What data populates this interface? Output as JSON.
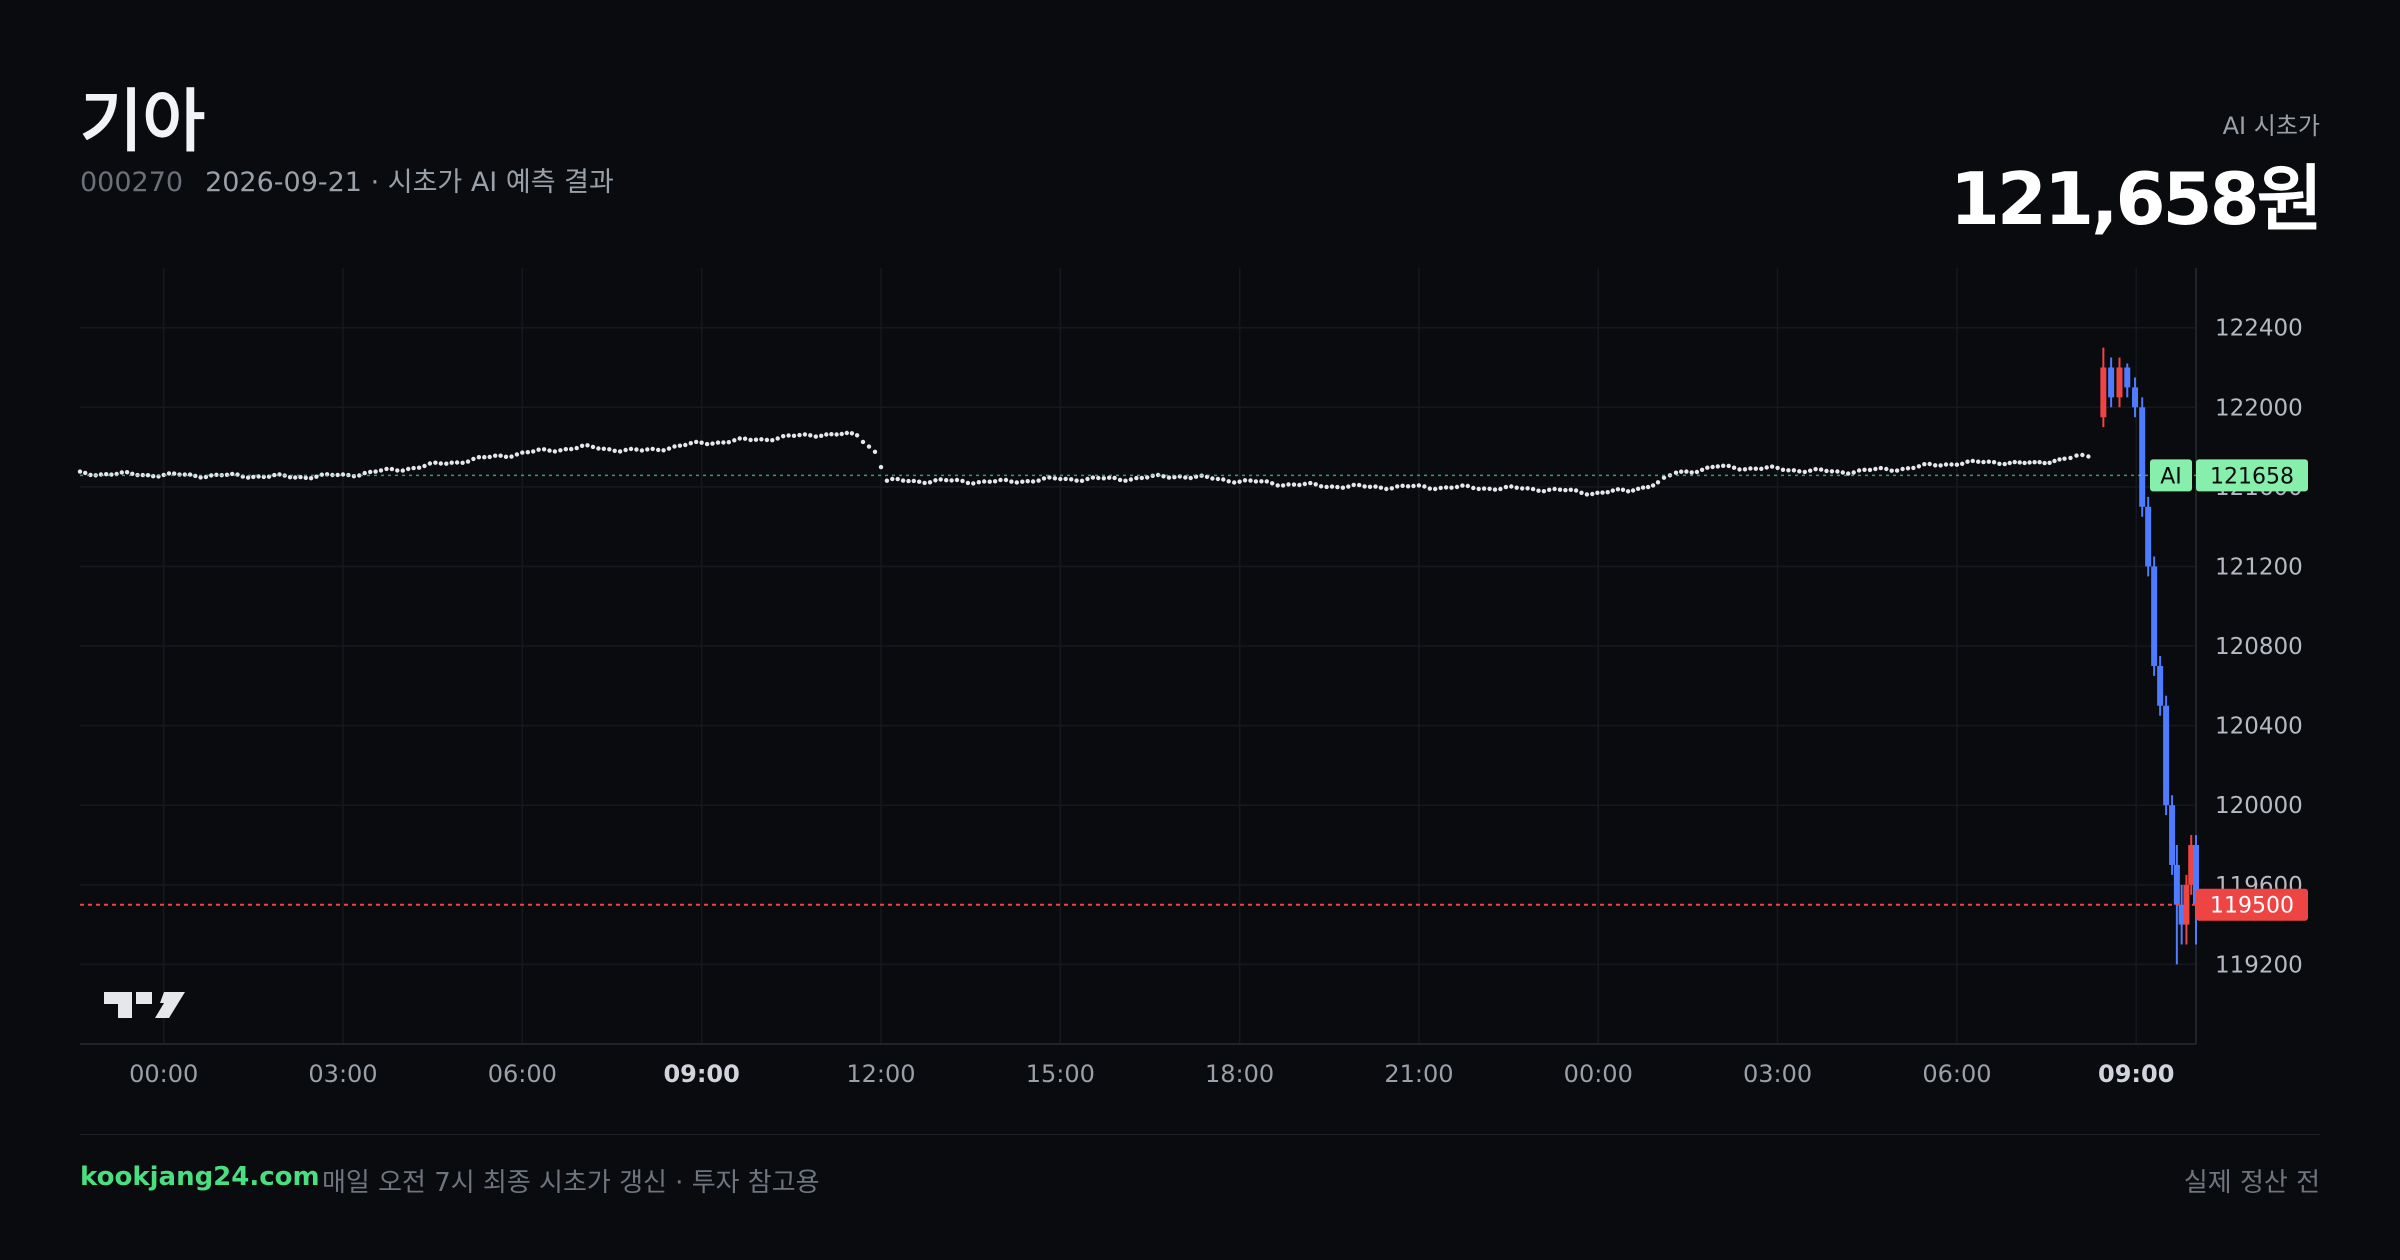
{
  "header": {
    "name": "기아",
    "code": "000270",
    "subtitle": "2026-09-21 · 시초가 AI 예측 결과",
    "ai_label": "AI 시초가",
    "ai_value": "121,658원"
  },
  "footer": {
    "site": "kookjang24.com",
    "tagline": "매일 오전 7시 최종 시초가 갱신 · 투자 참고용",
    "status": "실제 정산 전"
  },
  "colors": {
    "background": "#0a0b0f",
    "ai_line": "#4ade80",
    "ai_badge": "#86efac",
    "current_price": "#ef4444",
    "candle_up": "#ef4444",
    "candle_down": "#4f7cff",
    "dots": "#e5e7eb",
    "grid": "#15181e"
  },
  "chart_data": {
    "type": "line",
    "ylim": [
      118800,
      122700
    ],
    "y_ticks": [
      122400,
      122000,
      121600,
      121200,
      120800,
      120400,
      120000,
      119600,
      119200
    ],
    "x_tick_labels": [
      "00:00",
      "03:00",
      "06:00",
      "09:00",
      "12:00",
      "15:00",
      "18:00",
      "21:00",
      "00:00",
      "03:00",
      "06:00",
      "09:00"
    ],
    "bold_ticks": [
      3,
      11
    ],
    "x_range_hours": [
      -1.4,
      34.0
    ],
    "tick_hours": [
      0,
      3,
      6,
      9,
      12,
      15,
      18,
      21,
      24,
      27,
      30,
      33
    ],
    "ai_line": {
      "label": "AI",
      "value": 121658
    },
    "current_price": {
      "value": 119500
    },
    "prediction_series": [
      [
        -1.4,
        121668
      ],
      [
        0,
        121660
      ],
      [
        1.5,
        121655
      ],
      [
        2.2,
        121650
      ],
      [
        3,
        121658
      ],
      [
        4,
        121690
      ],
      [
        5,
        121730
      ],
      [
        6,
        121770
      ],
      [
        7,
        121800
      ],
      [
        8,
        121780
      ],
      [
        9,
        121820
      ],
      [
        10,
        121840
      ],
      [
        11,
        121865
      ],
      [
        11.6,
        121860
      ],
      [
        11.9,
        121780
      ],
      [
        12.1,
        121630
      ],
      [
        13,
        121630
      ],
      [
        14,
        121625
      ],
      [
        15,
        121640
      ],
      [
        16,
        121640
      ],
      [
        17,
        121655
      ],
      [
        18,
        121630
      ],
      [
        19,
        121610
      ],
      [
        20,
        121600
      ],
      [
        21,
        121600
      ],
      [
        22,
        121595
      ],
      [
        23,
        121590
      ],
      [
        23.9,
        121570
      ],
      [
        24.5,
        121580
      ],
      [
        25,
        121620
      ],
      [
        25.3,
        121670
      ],
      [
        26,
        121700
      ],
      [
        27,
        121690
      ],
      [
        28,
        121675
      ],
      [
        29,
        121690
      ],
      [
        30,
        121720
      ],
      [
        30.8,
        121725
      ],
      [
        31.3,
        121715
      ],
      [
        31.8,
        121745
      ],
      [
        32.2,
        121752
      ],
      [
        32.3,
        121770
      ]
    ],
    "candles": [
      [
        32.45,
        121950,
        122200,
        122300,
        121900
      ],
      [
        32.58,
        122200,
        122050,
        122250,
        122000
      ],
      [
        32.72,
        122050,
        122200,
        122250,
        122000
      ],
      [
        32.85,
        122200,
        122100,
        122220,
        122050
      ],
      [
        32.98,
        122100,
        122000,
        122150,
        121950
      ],
      [
        33.1,
        122000,
        121500,
        122050,
        121450
      ],
      [
        33.2,
        121500,
        121200,
        121550,
        121150
      ],
      [
        33.3,
        121200,
        120700,
        121250,
        120650
      ],
      [
        33.4,
        120700,
        120500,
        120750,
        120450
      ],
      [
        33.5,
        120500,
        120000,
        120550,
        119950
      ],
      [
        33.6,
        120000,
        119700,
        120050,
        119650
      ],
      [
        33.68,
        119700,
        119500,
        119800,
        119200
      ],
      [
        33.76,
        119500,
        119400,
        119600,
        119300
      ],
      [
        33.84,
        119400,
        119600,
        119650,
        119300
      ],
      [
        33.92,
        119600,
        119800,
        119850,
        119550
      ],
      [
        34.0,
        119800,
        119500,
        119850,
        119300
      ]
    ]
  }
}
